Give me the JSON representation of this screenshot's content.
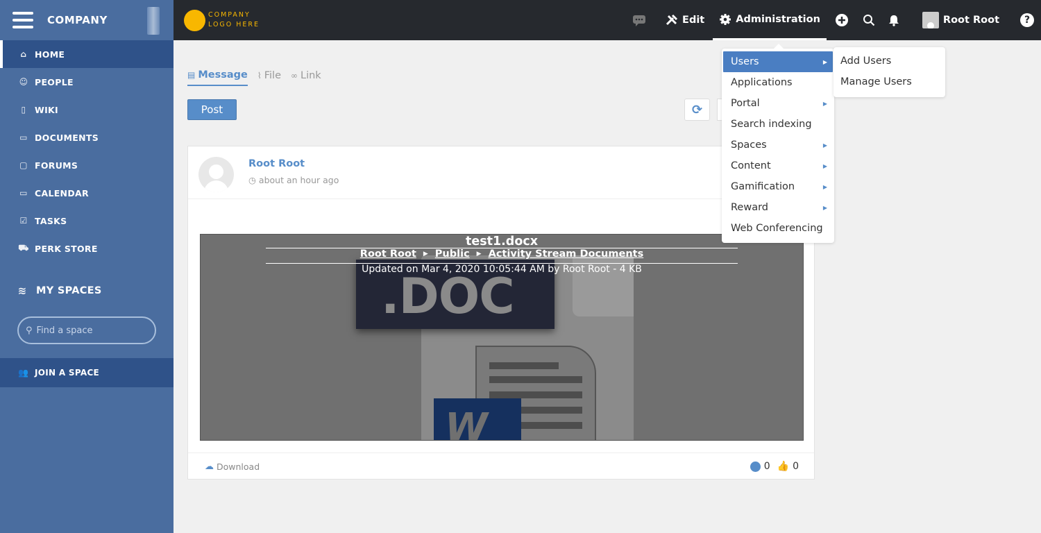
{
  "sidebar": {
    "company": "COMPANY",
    "items": [
      {
        "label": "HOME",
        "icon": "home-icon"
      },
      {
        "label": "PEOPLE",
        "icon": "people-icon"
      },
      {
        "label": "WIKI",
        "icon": "book-icon"
      },
      {
        "label": "DOCUMENTS",
        "icon": "folder-icon"
      },
      {
        "label": "FORUMS",
        "icon": "forum-icon"
      },
      {
        "label": "CALENDAR",
        "icon": "calendar-icon"
      },
      {
        "label": "TASKS",
        "icon": "checkbox-icon"
      },
      {
        "label": "PERK STORE",
        "icon": "cart-icon"
      }
    ],
    "my_spaces": "MY SPACES",
    "find_space_placeholder": "Find a space",
    "join_space": "JOIN A SPACE"
  },
  "topbar": {
    "logo_line1": "COMPANY",
    "logo_line2": "LOGO HERE",
    "edit": "Edit",
    "administration": "Administration",
    "user_name": "Root Root",
    "help": "?"
  },
  "composer": {
    "tabs": [
      "Message",
      "File",
      "Link"
    ],
    "post": "Post"
  },
  "activity": {
    "author": "Root Root",
    "time": "about an hour ago",
    "file_title": "test1.docx",
    "breadcrumb": [
      "Root Root",
      "Public",
      "Activity Stream Documents"
    ],
    "updated": "Updated on Mar 4, 2020 10:05:44 AM by Root Root - 4 KB",
    "badge_text": ".DOC",
    "download": "Download",
    "comments": "0",
    "likes": "0"
  },
  "admin_menu": {
    "items": [
      {
        "label": "Users",
        "has_sub": true,
        "active": true
      },
      {
        "label": "Applications",
        "has_sub": false
      },
      {
        "label": "Portal",
        "has_sub": true
      },
      {
        "label": "Search indexing",
        "has_sub": false
      },
      {
        "label": "Spaces",
        "has_sub": true
      },
      {
        "label": "Content",
        "has_sub": true
      },
      {
        "label": "Gamification",
        "has_sub": true
      },
      {
        "label": "Reward",
        "has_sub": true
      },
      {
        "label": "Web Conferencing",
        "has_sub": false
      }
    ],
    "users_submenu": [
      "Add Users",
      "Manage Users"
    ]
  },
  "colors": {
    "sidebar": "#4a6d9f",
    "sidebar_active": "#2f5289",
    "topbar": "#26292e",
    "accent": "#578dc9",
    "logo": "#f8b700"
  }
}
